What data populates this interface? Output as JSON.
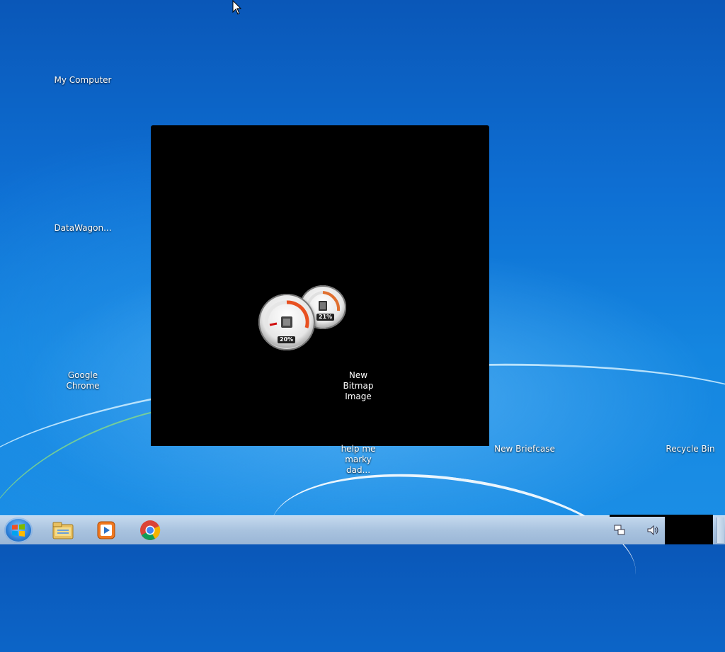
{
  "desktop": {
    "icons": [
      {
        "label": "My Computer"
      },
      {
        "label": "DataWagon..."
      },
      {
        "label": "Google Chrome"
      },
      {
        "label": "New Bitmap Image"
      },
      {
        "label": "help me marky dad..."
      },
      {
        "label": "New Briefcase"
      },
      {
        "label": "Recycle Bin"
      }
    ]
  },
  "gadget": {
    "cpu_percent": "20%",
    "memory_percent": "21%"
  },
  "taskbar": {
    "pinned": [
      {
        "name": "windows-explorer"
      },
      {
        "name": "media-player"
      },
      {
        "name": "google-chrome"
      }
    ]
  },
  "colors": {
    "desktop_blue": "#1486e0",
    "taskbar": "#a9c3df"
  }
}
